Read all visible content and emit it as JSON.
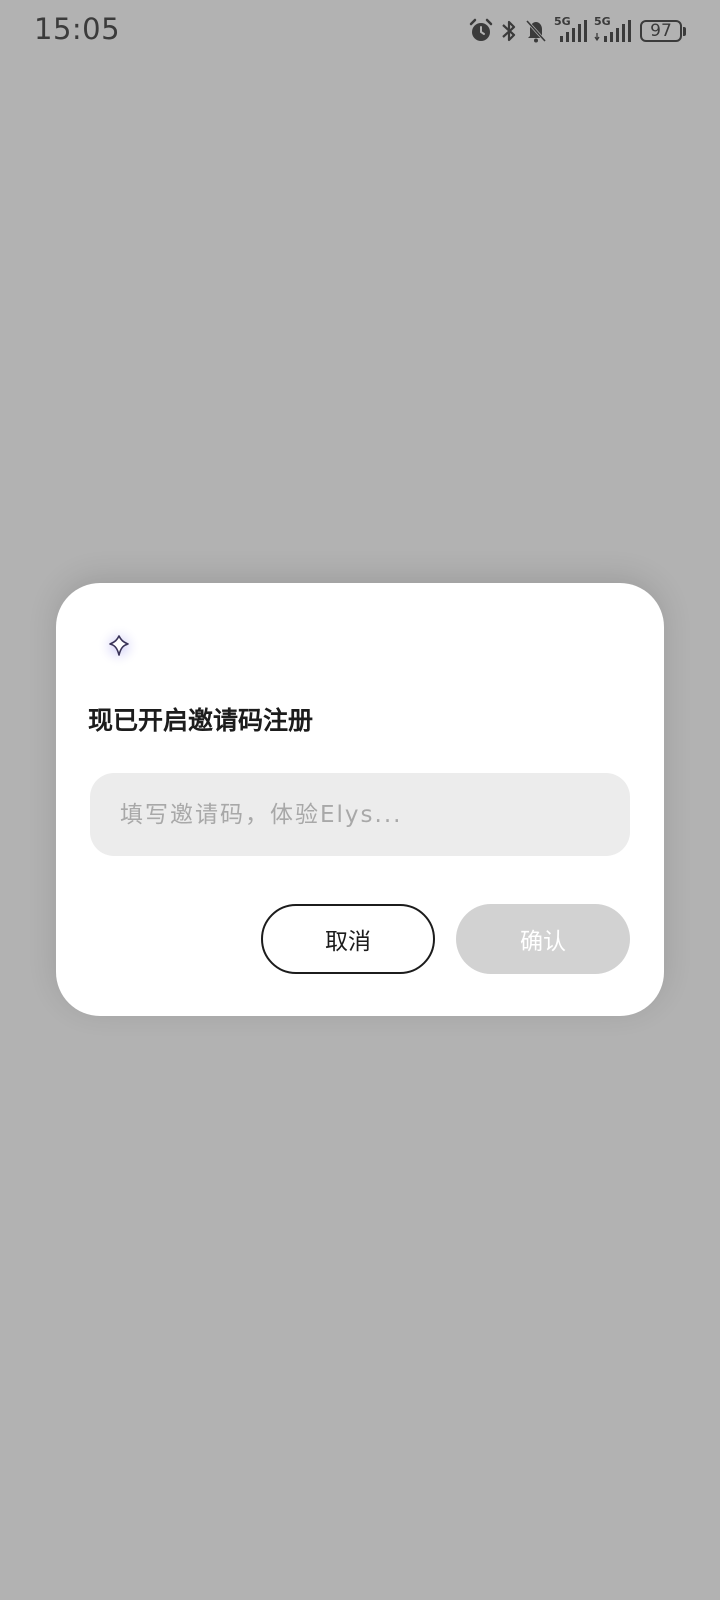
{
  "status_bar": {
    "time": "15:05",
    "icons": [
      "alarm-icon",
      "bluetooth-icon",
      "notifications-off-icon",
      "signal-5g-sim1-icon",
      "signal-5g-sim2-icon"
    ],
    "network_label_1": "5G",
    "network_label_2": "5G",
    "battery": "97"
  },
  "dialog": {
    "logo_icon": "sparkle-diamond-logo",
    "title": "现已开启邀请码注册",
    "input": {
      "value": "",
      "placeholder": "填写邀请码，体验Elys..."
    },
    "cancel_label": "取消",
    "confirm_label": "确认",
    "confirm_enabled": false
  },
  "colors": {
    "overlay": "#b2b2b2",
    "dialog_bg": "#ffffff",
    "input_bg": "#ececec",
    "confirm_disabled_bg": "#d2d2d2",
    "text_primary": "#1c1c1c"
  }
}
